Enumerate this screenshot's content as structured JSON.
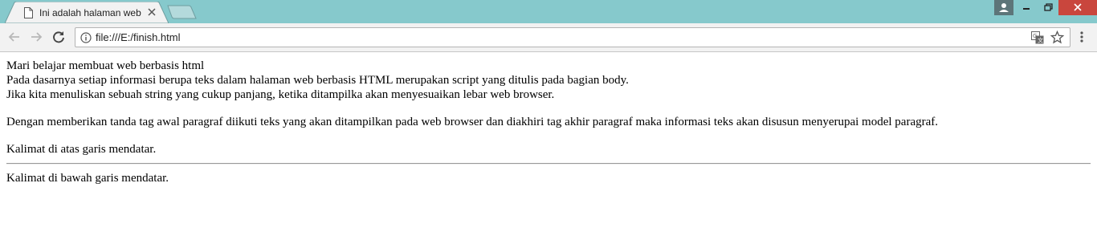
{
  "browser": {
    "tab_title": "Ini adalah halaman web",
    "url": "file:///E:/finish.html",
    "colors": {
      "tabstrip": "#86c9cc",
      "close_button": "#c9463d",
      "profile_button": "#5d7579"
    },
    "icons": [
      "page-icon",
      "tab-close-icon",
      "new-tab-icon",
      "profile-icon",
      "minimize-icon",
      "restore-icon",
      "close-icon",
      "back-icon",
      "forward-icon",
      "reload-icon",
      "info-icon",
      "translate-icon",
      "star-icon",
      "menu-icon"
    ]
  },
  "page": {
    "line1": "Mari belajar membuat web berbasis html",
    "line2": "Pada dasarnya setiap informasi berupa teks dalam halaman web berbasis HTML merupakan script yang ditulis pada bagian body.",
    "line3": "Jika kita menuliskan sebuah string yang cukup panjang, ketika ditampilka akan menyesuaikan lebar web browser.",
    "paragraph": "Dengan memberikan tanda tag awal paragraf diikuti teks yang akan ditampilkan pada web browser dan diakhiri tag akhir paragraf maka informasi teks akan disusun menyerupai model paragraf.",
    "above_hr": "Kalimat di atas garis mendatar.",
    "below_hr": "Kalimat di bawah garis mendatar."
  }
}
